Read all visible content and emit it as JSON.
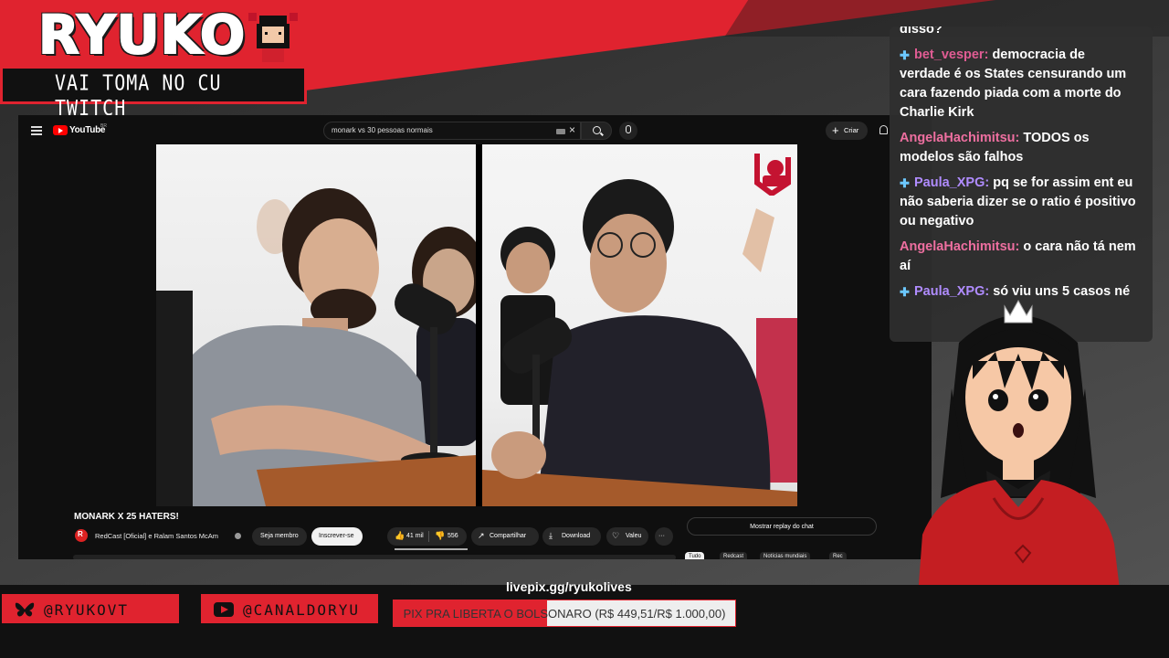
{
  "overlay": {
    "brand_title": "RYUKO",
    "brand_subtitle": "VAI TOMA NO CU TWITCH",
    "socials": [
      {
        "label": "@RYUKOVT",
        "icon": "butterfly-icon"
      },
      {
        "label": "@CANALDORYU",
        "icon": "youtube-icon"
      }
    ],
    "livepix_url": "livepix.gg/ryukolives",
    "donation_goal": {
      "text": "PIX PRA LIBERTA O BOLSONARO (R$ 449,51/R$ 1.000,00)",
      "current": 449.51,
      "target": 1000.0
    }
  },
  "youtube": {
    "logo_text": "YouTube",
    "logo_sup": "BR",
    "search_query": "monark vs 30 pessoas normais",
    "create_label": "Criar",
    "video_title": "MONARK X 25 HATERS!",
    "channel_name": "RedCast [Oficial] e Ralam Santos McAm",
    "member_label": "Seja membro",
    "subscribe_label": "Inscrever-se",
    "likes": "41 mil",
    "comments": "556",
    "share_label": "Compartilhar",
    "download_label": "Download",
    "thanks_label": "Valeu",
    "more_label": "···",
    "chat_replay_label": "Mostrar replay do chat",
    "chips": [
      "Tudo",
      "Redcast",
      "Notícias mundiais",
      "Rec"
    ]
  },
  "chat": {
    "messages": [
      {
        "user": "",
        "text": "disso?",
        "badge": false
      },
      {
        "user": "bet_vesper:",
        "text": "democracia de verdade é os States censurando um cara fazendo piada com a morte do Charlie Kirk",
        "badge": true
      },
      {
        "user": "AngelaHachimitsu:",
        "text": "TODOS os modelos são falhos",
        "badge": false
      },
      {
        "user": "Paula_XPG:",
        "text": "pq se for assim ent eu não saberia dizer se o ratio é positivo ou negativo",
        "badge": true
      },
      {
        "user": "AngelaHachimitsu:",
        "text": "o cara não tá nem aí",
        "badge": false
      },
      {
        "user": "Paula_XPG:",
        "text": "só viu uns 5 casos né",
        "badge": true
      }
    ]
  },
  "colors": {
    "accent": "#e0232f",
    "chat_bg": "#2e2e2e",
    "youtube_bg": "#0f0f0f"
  }
}
